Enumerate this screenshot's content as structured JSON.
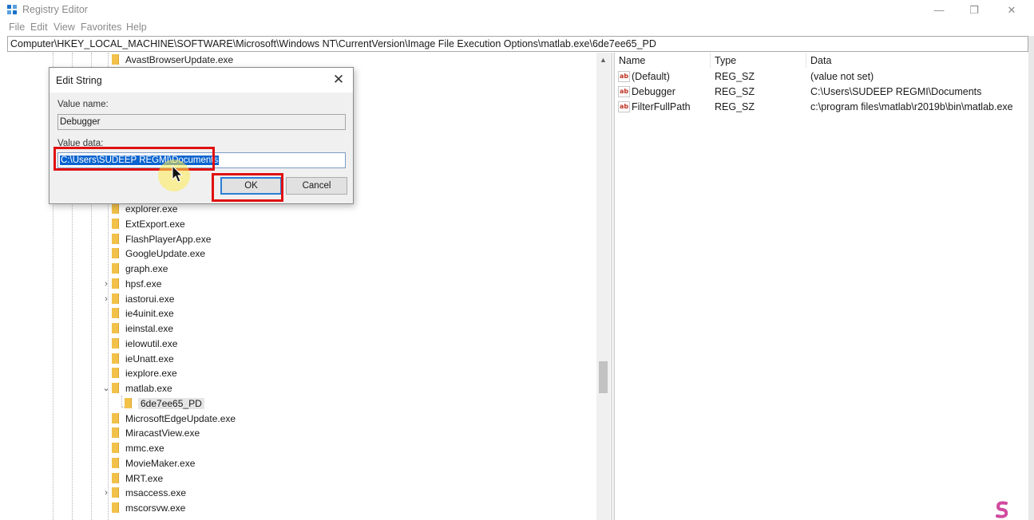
{
  "window": {
    "title": "Registry Editor",
    "minimize_glyph": "—",
    "restore_glyph": "❐",
    "close_glyph": "✕"
  },
  "menu": [
    "File",
    "Edit",
    "View",
    "Favorites",
    "Help"
  ],
  "address": "Computer\\HKEY_LOCAL_MACHINE\\SOFTWARE\\Microsoft\\Windows NT\\CurrentVersion\\Image File Execution Options\\matlab.exe\\6de7ee65_PD",
  "tree": {
    "top_item": "AvastBrowserUpdate.exe",
    "items": [
      {
        "label": "explorer.exe",
        "expandable": false
      },
      {
        "label": "ExtExport.exe",
        "expandable": false
      },
      {
        "label": "FlashPlayerApp.exe",
        "expandable": false
      },
      {
        "label": "GoogleUpdate.exe",
        "expandable": false
      },
      {
        "label": "graph.exe",
        "expandable": false
      },
      {
        "label": "hpsf.exe",
        "expandable": true
      },
      {
        "label": "iastorui.exe",
        "expandable": true
      },
      {
        "label": "ie4uinit.exe",
        "expandable": false
      },
      {
        "label": "ieinstal.exe",
        "expandable": false
      },
      {
        "label": "ielowutil.exe",
        "expandable": false
      },
      {
        "label": "ieUnatt.exe",
        "expandable": false
      },
      {
        "label": "iexplore.exe",
        "expandable": false
      },
      {
        "label": "matlab.exe",
        "expandable": true,
        "expanded": true
      },
      {
        "label": "6de7ee65_PD",
        "child": true,
        "selected": true
      },
      {
        "label": "MicrosoftEdgeUpdate.exe",
        "expandable": false
      },
      {
        "label": "MiracastView.exe",
        "expandable": false
      },
      {
        "label": "mmc.exe",
        "expandable": false
      },
      {
        "label": "MovieMaker.exe",
        "expandable": false
      },
      {
        "label": "MRT.exe",
        "expandable": false
      },
      {
        "label": "msaccess.exe",
        "expandable": true
      },
      {
        "label": "mscorsvw.exe",
        "expandable": false
      }
    ]
  },
  "values": {
    "columns": [
      "Name",
      "Type",
      "Data"
    ],
    "rows": [
      {
        "name": "(Default)",
        "type": "REG_SZ",
        "data": "(value not set)"
      },
      {
        "name": "Debugger",
        "type": "REG_SZ",
        "data": "C:\\Users\\SUDEEP REGMI\\Documents"
      },
      {
        "name": "FilterFullPath",
        "type": "REG_SZ",
        "data": "c:\\program files\\matlab\\r2019b\\bin\\matlab.exe"
      }
    ],
    "string_icon": "ab"
  },
  "dialog": {
    "title": "Edit String",
    "value_name_label": "Value name:",
    "value_name": "Debugger",
    "value_data_label": "Value data:",
    "value_data": "C:\\Users\\SUDEEP REGMI\\Documents",
    "ok_label": "OK",
    "cancel_label": "Cancel",
    "close_glyph": "✕"
  },
  "colors": {
    "annotation_red": "#e01010",
    "selection_blue": "#0a64cf",
    "folder_yellow": "#f2c14a"
  }
}
